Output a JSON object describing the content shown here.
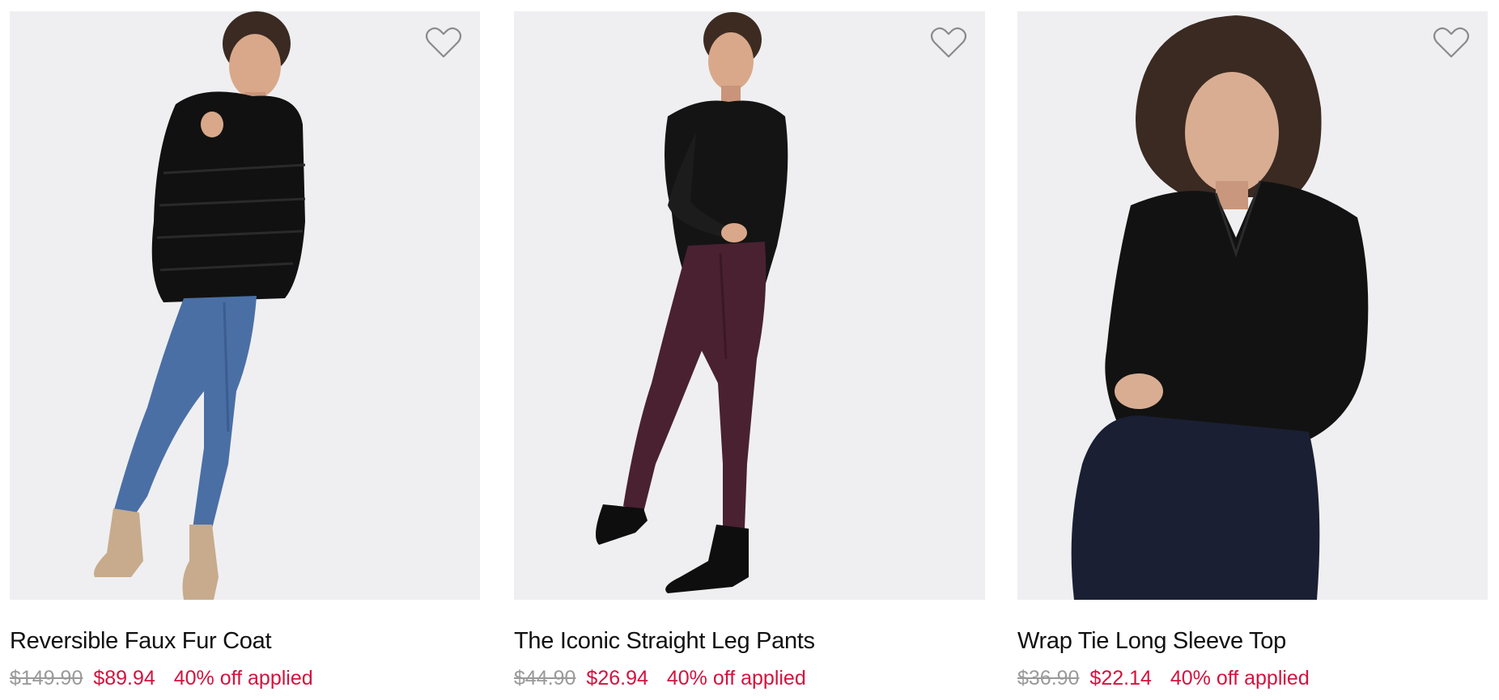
{
  "products": [
    {
      "name": "Reversible Faux Fur Coat",
      "original_price": "$149.90",
      "sale_price": "$89.94",
      "promo": "40% off applied",
      "wishlist_icon": "heart-outline-icon"
    },
    {
      "name": "The Iconic Straight Leg Pants",
      "original_price": "$44.90",
      "sale_price": "$26.94",
      "promo": "40% off applied",
      "wishlist_icon": "heart-outline-icon"
    },
    {
      "name": "Wrap Tie Long Sleeve Top",
      "original_price": "$36.90",
      "sale_price": "$22.14",
      "promo": "40% off applied",
      "wishlist_icon": "heart-outline-icon"
    }
  ],
  "colors": {
    "sale": "#d4123e",
    "strikethrough": "#9a9a9a",
    "photo_background": "#efeff1"
  }
}
